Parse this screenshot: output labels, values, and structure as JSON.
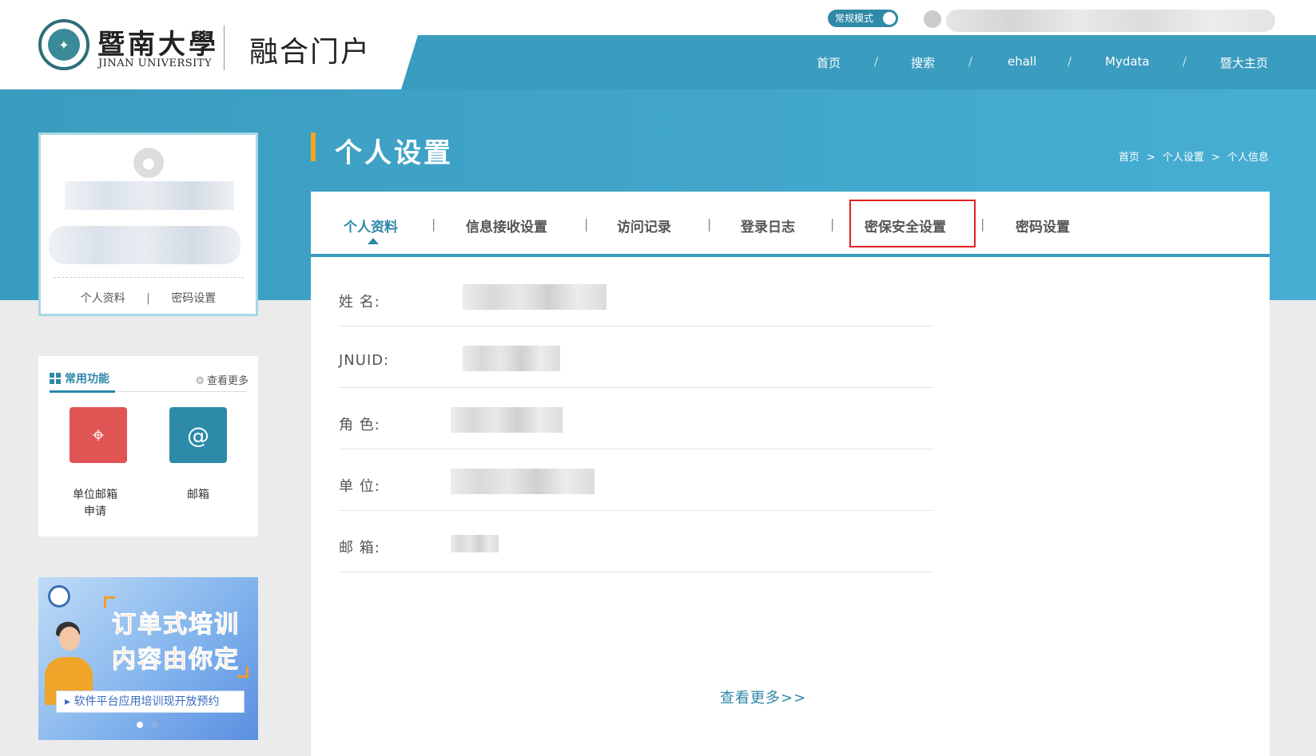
{
  "header": {
    "logo_cn": "暨南大學",
    "logo_en": "JINAN UNIVERSITY",
    "portal_title": "融合门户",
    "mode_toggle_label": "常规模式",
    "nav": [
      {
        "label": "首页"
      },
      {
        "label": "搜索"
      },
      {
        "label": "ehall"
      },
      {
        "label": "Mydata"
      },
      {
        "label": "暨大主页"
      }
    ],
    "nav_separator": "/"
  },
  "profile_card": {
    "links": [
      {
        "label": "个人资料"
      },
      {
        "label": "密码设置"
      }
    ],
    "separator": "|"
  },
  "common_functions": {
    "title": "常用功能",
    "more_label": "查看更多",
    "items": [
      {
        "label_line1": "单位邮箱",
        "label_line2": "申请",
        "icon": "map-pin-icon",
        "color": "#e05454"
      },
      {
        "label_line1": "邮箱",
        "label_line2": "",
        "icon": "email-icon",
        "color": "#2d8aa8"
      }
    ]
  },
  "ad_banner": {
    "headline_1": "订单式培训",
    "headline_2": "内容由你定",
    "caption": "▸ 软件平台应用培训现开放预约"
  },
  "page": {
    "title": "个人设置",
    "breadcrumb": [
      "首页",
      "个人设置",
      "个人信息"
    ],
    "breadcrumb_separator": ">"
  },
  "tabs": [
    {
      "label": "个人资料",
      "active": true
    },
    {
      "label": "信息接收设置",
      "active": false
    },
    {
      "label": "访问记录",
      "active": false
    },
    {
      "label": "登录日志",
      "active": false
    },
    {
      "label": "密保安全设置",
      "active": false,
      "highlighted": true
    },
    {
      "label": "密码设置",
      "active": false
    }
  ],
  "tab_separator": "|",
  "info_rows": [
    {
      "label": "姓 名:"
    },
    {
      "label": "JNUID:"
    },
    {
      "label": "角 色:"
    },
    {
      "label": "单 位:"
    },
    {
      "label": "邮 箱:"
    }
  ],
  "see_more_label": "查看更多>>",
  "colors": {
    "brand_blue": "#3a9cbf",
    "accent_orange": "#f5a623",
    "active_tab": "#2d87aa",
    "highlight_red": "#e02020"
  }
}
